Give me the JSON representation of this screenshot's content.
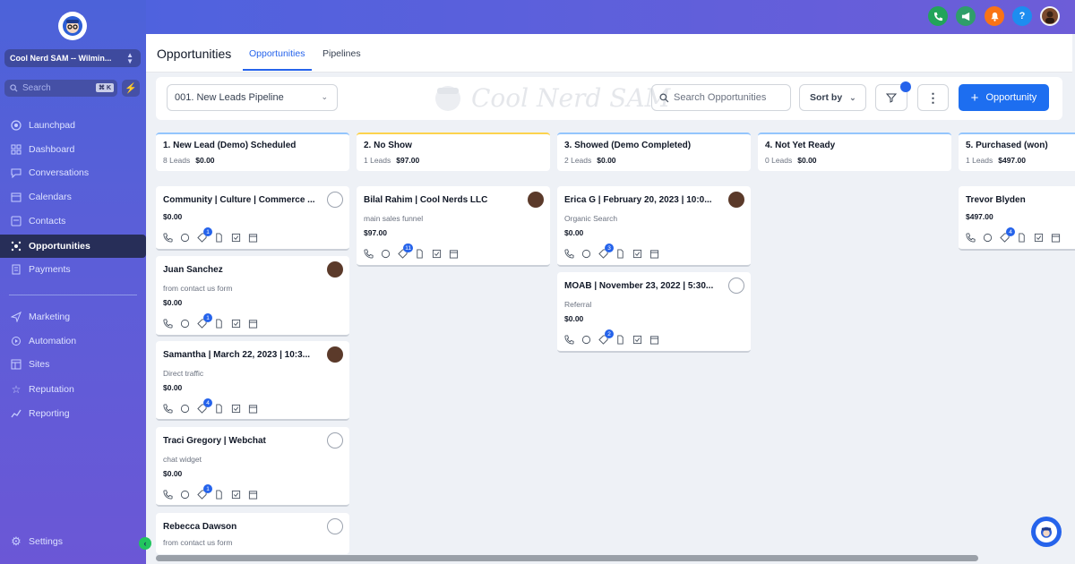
{
  "sidebar": {
    "account": "Cool Nerd SAM -- Wilmin...",
    "search_placeholder": "Search",
    "search_shortcut": "⌘ K",
    "items": [
      {
        "label": "Launchpad",
        "icon": "launchpad-icon"
      },
      {
        "label": "Dashboard",
        "icon": "dashboard-icon"
      },
      {
        "label": "Conversations",
        "icon": "chat-icon"
      },
      {
        "label": "Calendars",
        "icon": "calendar-icon"
      },
      {
        "label": "Contacts",
        "icon": "contacts-icon"
      },
      {
        "label": "Opportunities",
        "icon": "opportunities-icon",
        "active": true
      },
      {
        "label": "Payments",
        "icon": "payments-icon"
      },
      {
        "label": "Marketing",
        "icon": "send-icon"
      },
      {
        "label": "Automation",
        "icon": "automation-icon"
      },
      {
        "label": "Sites",
        "icon": "sites-icon"
      },
      {
        "label": "Reputation",
        "icon": "star-icon"
      },
      {
        "label": "Reporting",
        "icon": "chart-icon"
      }
    ],
    "settings": "Settings"
  },
  "header": {
    "title": "Opportunities",
    "tabs": [
      "Opportunities",
      "Pipelines"
    ]
  },
  "toolbar": {
    "pipeline": "001. New Leads Pipeline",
    "watermark": "Cool Nerd SAM",
    "search_placeholder": "Search Opportunities",
    "sort_label": "Sort by",
    "add_label": "Opportunity"
  },
  "columns": [
    {
      "title": "1. New Lead (Demo) Scheduled",
      "count": "8 Leads",
      "total": "$0.00"
    },
    {
      "title": "2. No Show",
      "count": "1 Leads",
      "total": "$97.00"
    },
    {
      "title": "3. Showed (Demo Completed)",
      "count": "2 Leads",
      "total": "$0.00"
    },
    {
      "title": "4. Not Yet Ready",
      "count": "0 Leads",
      "total": "$0.00"
    },
    {
      "title": "5. Purchased (won)",
      "count": "1 Leads",
      "total": "$497.00"
    }
  ],
  "cards": {
    "c1": {
      "name": "Community | Culture | Commerce ...",
      "source": "",
      "amount": "$0.00",
      "badge": "1"
    },
    "c2": {
      "name": "Juan Sanchez",
      "source": "from contact us form",
      "amount": "$0.00",
      "badge": "1"
    },
    "c3": {
      "name": "Samantha | March 22, 2023 | 10:3...",
      "source": "Direct traffic",
      "amount": "$0.00",
      "badge": "4"
    },
    "c4": {
      "name": "Traci Gregory | Webchat",
      "source": "chat widget",
      "amount": "$0.00",
      "badge": "1"
    },
    "c5": {
      "name": "Rebecca Dawson",
      "source": "from contact us form",
      "amount": "",
      "badge": ""
    },
    "c6": {
      "name": "Bilal Rahim | Cool Nerds LLC",
      "source": "main sales funnel",
      "amount": "$97.00",
      "badge": "11"
    },
    "c7": {
      "name": "Erica G | February 20, 2023 | 10:0...",
      "source": "Organic Search",
      "amount": "$0.00",
      "badge": "3"
    },
    "c8": {
      "name": "MOAB | November 23, 2022 | 5:30...",
      "source": "Referral",
      "amount": "$0.00",
      "badge": "2"
    },
    "c9": {
      "name": "Trevor Blyden",
      "source": "",
      "amount": "$497.00",
      "badge": "4"
    }
  },
  "topbar_icons": [
    "phone-icon",
    "megaphone-icon",
    "bell-icon",
    "help-icon",
    "user-avatar"
  ],
  "colors": {
    "accent": "#2563eb",
    "sidebar": "#5a5fd8",
    "active_nav": "#272e58"
  }
}
